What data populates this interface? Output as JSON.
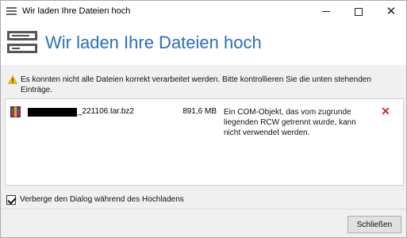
{
  "window": {
    "title": "Wir laden Ihre Dateien hoch"
  },
  "header": {
    "title": "Wir laden Ihre Dateien hoch"
  },
  "warning": {
    "text": "Es konnten nicht alle Dateien korrekt verarbeitet werden. Bitte kontrollieren Sie die unten stehenden Einträge."
  },
  "files": [
    {
      "name_suffix": "_221106.tar.bz2",
      "size": "891,6 MB",
      "error": "Ein COM-Objekt, das vom zugrunde liegenden RCW getrennt wurde, kann nicht verwendet werden."
    }
  ],
  "options": {
    "hide_dialog_label": "Verberge den Dialog während des Hochladens",
    "hide_dialog_checked": true
  },
  "footer": {
    "close_label": "Schließen"
  },
  "colors": {
    "title_blue": "#2a6fb8",
    "delete_red": "#d22a2a",
    "warning_yellow": "#f2c200"
  }
}
